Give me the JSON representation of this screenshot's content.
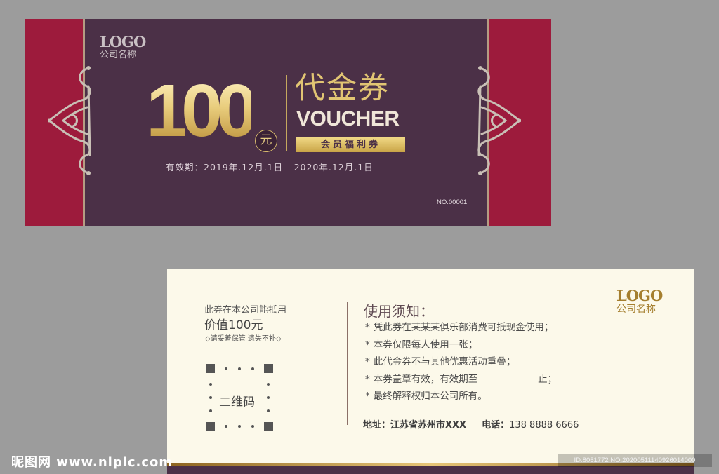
{
  "front": {
    "logo": "LOGO",
    "company": "公司名称",
    "amount": "100",
    "currency": "元",
    "title_cn": "代金券",
    "title_en": "VOUCHER",
    "badge": "会员福利券",
    "validity": "有效期：2019年.12月.1日 - 2020年.12月.1日",
    "serial": "NO:00001",
    "colors": {
      "purple": "#4b3047",
      "crimson": "#9d1b3c",
      "gold": "#e2c573"
    },
    "ornament_icon": "filigree-ornament-icon"
  },
  "back": {
    "logo": "LOGO",
    "company": "公司名称",
    "usable_text": "此券在本公司能抵用",
    "value_text": "价值100元",
    "keep_note": "◇请妥善保管 遗失不补◇",
    "qr_label": "二维码",
    "notice_title": "使用须知：",
    "rules": [
      "凭此券在某某某俱乐部消费可抵现金使用；",
      "本券仅限每人使用一张；",
      "此代金券不与其他优惠活动重叠；",
      "本券盖章有效，有效期至                    止；",
      "最终解释权归本公司所有。"
    ],
    "rule_marker": "*",
    "address_label": "地址：",
    "address": "江苏省苏州市XXX",
    "phone_label": "电话：",
    "phone": "138 8888 6666"
  },
  "watermark": {
    "site": "昵图网 www.nipic.com",
    "id": "ID:8051772 NO:20200511140926014000"
  }
}
